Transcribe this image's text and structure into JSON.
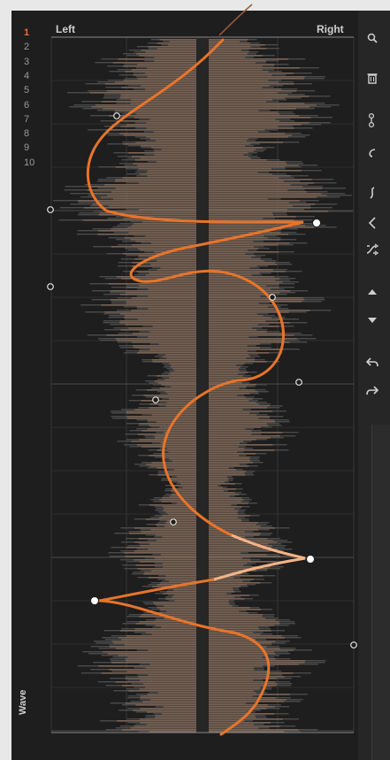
{
  "rows": [
    "1",
    "2",
    "3",
    "4",
    "5",
    "6",
    "7",
    "8",
    "9",
    "10"
  ],
  "active_row": 0,
  "header": {
    "left": "Left",
    "right": "Right"
  },
  "wave_label": "Wave",
  "colors": {
    "accent": "#e8742a",
    "accent_light": "#f2b48a",
    "waveform": "#7a6556",
    "background": "#1e1e1e",
    "grid": "#3a3a3a"
  },
  "toolbar": [
    {
      "name": "search-icon"
    },
    {
      "name": "trash-icon"
    },
    {
      "name": "node-link-icon"
    },
    {
      "name": "curve-hook-icon"
    },
    {
      "name": "s-curve-icon"
    },
    {
      "name": "angle-left-icon"
    },
    {
      "name": "shuffle-icon"
    },
    {
      "name": "move-up-icon"
    },
    {
      "name": "move-down-icon"
    },
    {
      "name": "undo-icon"
    },
    {
      "name": "redo-icon"
    }
  ]
}
